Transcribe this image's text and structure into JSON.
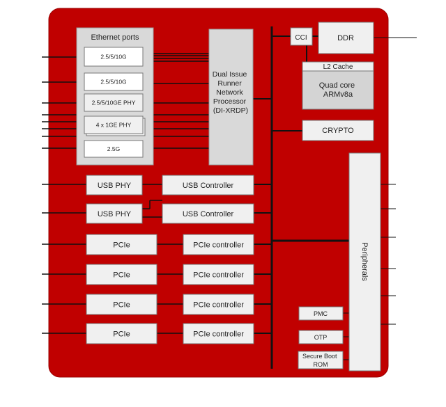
{
  "colors": {
    "chip": "#c00000",
    "block": "#f0f0f0",
    "group": "#d9d9d9",
    "bus": "#111111"
  },
  "ethernet": {
    "title": "Ethernet ports",
    "ports": [
      "2.5/5/10G",
      "2.5/5/10G",
      "2.5/5/10GE PHY",
      "4 x 1GE PHY",
      "2.5G"
    ]
  },
  "network_processor": {
    "lines": [
      "Dual Issue",
      "Runner",
      "Network",
      "Processor",
      "(DI-XRDP)"
    ]
  },
  "cci": "CCI",
  "ddr": "DDR",
  "l2_cache": "L2 Cache",
  "cpu": {
    "lines": [
      "Quad core",
      "ARMv8a"
    ]
  },
  "crypto": "CRYPTO",
  "peripherals": "Peripherals",
  "usb": {
    "phy": "USB PHY",
    "controller": "USB Controller"
  },
  "pcie": {
    "phy": "PCIe",
    "controller": "PCIe controller"
  },
  "pmc": "PMC",
  "otp": "OTP",
  "secure_boot": {
    "lines": [
      "Secure Boot",
      "ROM"
    ]
  }
}
